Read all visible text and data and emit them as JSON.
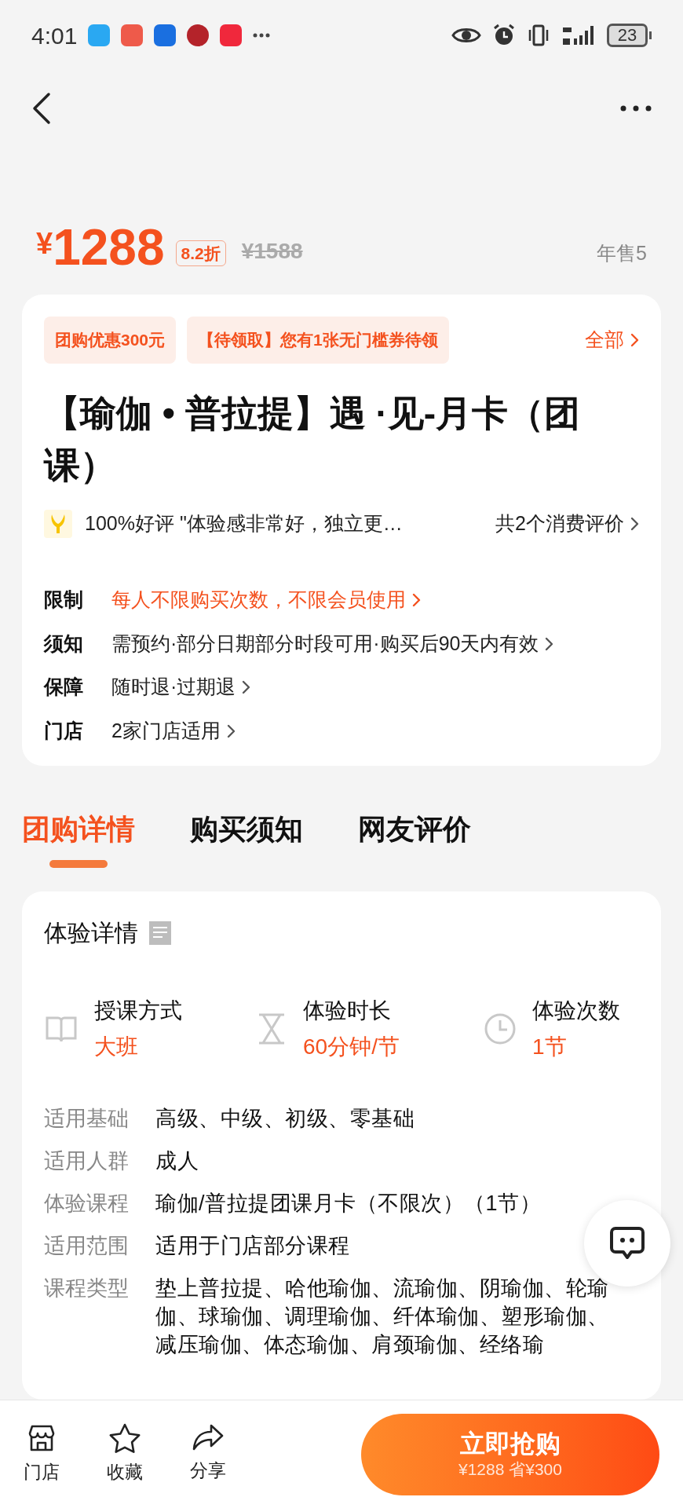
{
  "status_bar": {
    "time": "4:01",
    "battery": "23"
  },
  "price": {
    "symbol": "¥",
    "current": "1288",
    "discount": "8.2折",
    "original": "¥1588",
    "sales": "年售5"
  },
  "offers": {
    "tags": [
      "团购优惠300元",
      "【待领取】您有1张无门槛券待领"
    ],
    "all_link": "全部"
  },
  "title": "【瑜伽 • 普拉提】遇 ·见-月卡（团课）",
  "review": {
    "text": "100%好评 \"体验感非常好，独立更…",
    "count_link": "共2个消费评价"
  },
  "info_rows": [
    {
      "label": "限制",
      "value": "每人不限购买次数，不限会员使用",
      "emphasis": true
    },
    {
      "label": "须知",
      "value": "需预约·部分日期部分时段可用·购买后90天内有效",
      "emphasis": false
    },
    {
      "label": "保障",
      "value": "随时退·过期退",
      "emphasis": false
    },
    {
      "label": "门店",
      "value": "2家门店适用",
      "emphasis": false
    }
  ],
  "tabs": [
    {
      "label": "团购详情",
      "selected": true
    },
    {
      "label": "购买须知",
      "selected": false
    },
    {
      "label": "网友评价",
      "selected": false
    }
  ],
  "details": {
    "title": "体验详情",
    "stats": [
      {
        "kind": "book",
        "label": "授课方式",
        "value": "大班"
      },
      {
        "kind": "hourglass",
        "label": "体验时长",
        "value": "60分钟/节"
      },
      {
        "kind": "clock",
        "label": "体验次数",
        "value": "1节"
      }
    ],
    "specs": [
      {
        "label": "适用基础",
        "value": "高级、中级、初级、零基础"
      },
      {
        "label": "适用人群",
        "value": "成人"
      },
      {
        "label": "体验课程",
        "value": "瑜伽/普拉提团课月卡（不限次）（1节）"
      },
      {
        "label": "适用范围",
        "value": "适用于门店部分课程"
      },
      {
        "label": "课程类型",
        "value": "垫上普拉提、哈他瑜伽、流瑜伽、阴瑜伽、轮瑜伽、球瑜伽、调理瑜伽、纤体瑜伽、塑形瑜伽、减压瑜伽、体态瑜伽、肩颈瑜伽、经络瑜"
      }
    ]
  },
  "bottom_bar": {
    "actions": [
      {
        "kind": "store",
        "label": "门店"
      },
      {
        "kind": "star",
        "label": "收藏"
      },
      {
        "kind": "share",
        "label": "分享"
      }
    ],
    "buy": {
      "label": "立即抢购",
      "subline": "¥1288 省¥300"
    }
  }
}
